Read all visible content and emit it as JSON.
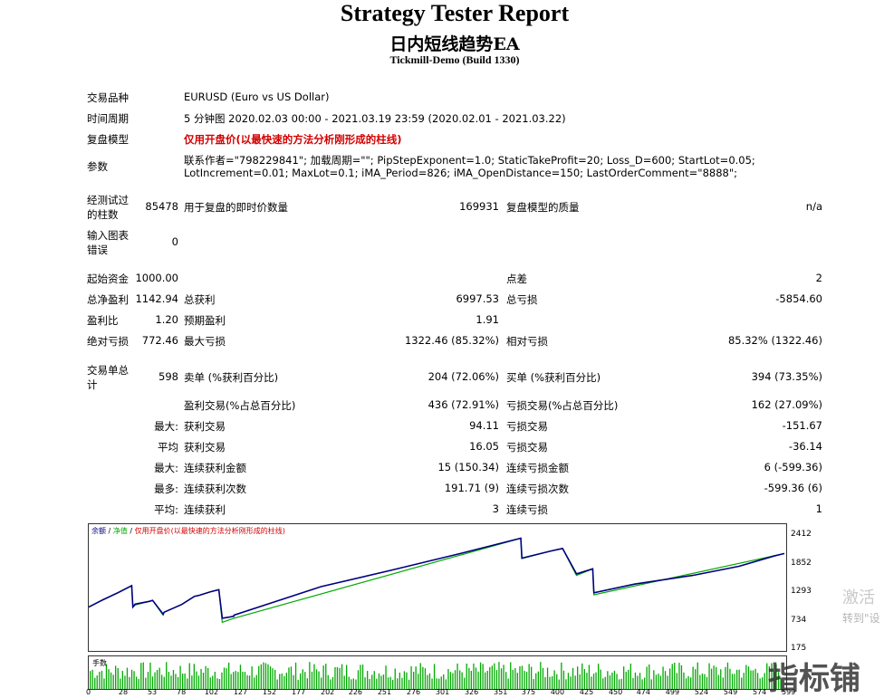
{
  "header": {
    "title": "Strategy Tester Report",
    "ea_name": "日内短线趋势EA",
    "build": "Tickmill-Demo (Build 1330)"
  },
  "info": {
    "symbol_label": "交易品种",
    "symbol_value": "EURUSD (Euro vs US Dollar)",
    "period_label": "时间周期",
    "period_value": "5 分钟图 2020.02.03 00:00 - 2021.03.19 23:59 (2020.02.01 - 2021.03.22)",
    "model_label": "复盘模型",
    "model_value": "仅用开盘价(以最快速的方法分析刚形成的柱线)",
    "params_label": "参数",
    "params_line1": "联系作者=\"798229841\"; 加载周期=\"\"; PipStepExponent=1.0; StaticTakeProfit=20; Loss_D=600; StartLot=0.05;",
    "params_line2": "LotIncrement=0.01; MaxLot=0.1; iMA_Period=826; iMA_OpenDistance=150; LastOrderComment=\"8888\";"
  },
  "bars": {
    "bars_label_1": "经测试过",
    "bars_label_2": "的柱数",
    "bars_value": "85478",
    "ticks_label": "用于复盘的即时价数量",
    "ticks_value": "169931",
    "quality_label": "复盘模型的质量",
    "quality_value": "n/a",
    "errors_label_1": "输入图表",
    "errors_label_2": "错误",
    "errors_value": "0"
  },
  "stats": {
    "deposit_label": "起始资金",
    "deposit_value": "1000.00",
    "spread_label": "点差",
    "spread_value": "2",
    "net_label": "总净盈利",
    "net_value": "1142.94",
    "gross_profit_label": "总获利",
    "gross_profit_value": "6997.53",
    "gross_loss_label": "总亏损",
    "gross_loss_value": "-5854.60",
    "pf_label": "盈利比",
    "pf_value": "1.20",
    "payoff_label": "预期盈利",
    "payoff_value": "1.91",
    "abs_dd_label": "绝对亏损",
    "abs_dd_value": "772.46",
    "max_dd_label": "最大亏损",
    "max_dd_value": "1322.46 (85.32%)",
    "rel_dd_label": "相对亏损",
    "rel_dd_value": "85.32% (1322.46)"
  },
  "trades": {
    "total_label_1": "交易单总",
    "total_label_2": "计",
    "total_value": "598",
    "short_label": "卖单 (%获利百分比)",
    "short_value": "204 (72.06%)",
    "long_label": "买单 (%获利百分比)",
    "long_value": "394 (73.35%)",
    "profit_trades_label": "盈利交易(%占总百分比)",
    "profit_trades_value": "436 (72.91%)",
    "loss_trades_label": "亏损交易(%占总百分比)",
    "loss_trades_value": "162 (27.09%)",
    "largest_label": "最大:",
    "largest_profit_label": "获利交易",
    "largest_profit_value": "94.11",
    "largest_loss_label": "亏损交易",
    "largest_loss_value": "-151.67",
    "average_label": "平均",
    "average_profit_label": "获利交易",
    "average_profit_value": "16.05",
    "average_loss_label": "亏损交易",
    "average_loss_value": "-36.14",
    "max_label": "最大:",
    "max_cons_wins_label": "连续获利金额",
    "max_cons_wins_value": "15 (150.34)",
    "max_cons_losses_label": "连续亏损金额",
    "max_cons_losses_value": "6 (-599.36)",
    "maximal_label": "最多:",
    "maximal_cons_profit_label": "连续获利次数",
    "maximal_cons_profit_value": "191.71 (9)",
    "maximal_cons_loss_label": "连续亏损次数",
    "maximal_cons_loss_value": "-599.36 (6)",
    "avg_label": "平均:",
    "avg_cons_wins_label": "连续获利",
    "avg_cons_wins_value": "3",
    "avg_cons_losses_label": "连续亏损",
    "avg_cons_losses_value": "1"
  },
  "graph": {
    "legend_balance": "余额",
    "legend_equity": "净值",
    "legend_model": "仅用开盘价(以最快速的方法分析刚形成的柱线)",
    "volume_label": "手数",
    "y_ticks": [
      "2412",
      "1852",
      "1293",
      "734",
      "175"
    ],
    "x_ticks": [
      "0",
      "28",
      "53",
      "78",
      "102",
      "127",
      "152",
      "177",
      "202",
      "226",
      "251",
      "276",
      "301",
      "326",
      "351",
      "375",
      "400",
      "425",
      "450",
      "474",
      "499",
      "524",
      "549",
      "574",
      "599"
    ],
    "balance_color": "#000080",
    "equity_color": "#00aa00",
    "model_color": "#d40000"
  },
  "chart_data": {
    "type": "line",
    "title": "",
    "xlabel": "",
    "ylabel": "",
    "ylim": [
      175,
      2412
    ],
    "xlim": [
      0,
      599
    ],
    "series": [
      {
        "name": "余额",
        "x": [
          0,
          12,
          25,
          37,
          38,
          40,
          52,
          55,
          64,
          65,
          80,
          91,
          95,
          105,
          112,
          115,
          125,
          125,
          200,
          260,
          320,
          372,
          373,
          398,
          408,
          420,
          434,
          435,
          470,
          520,
          560,
          590,
          599
        ],
        "values": [
          1000,
          1140,
          1280,
          1420,
          1000,
          1060,
          1110,
          1130,
          860,
          900,
          1050,
          1210,
          1230,
          1300,
          1340,
          780,
          820,
          840,
          1400,
          1720,
          2050,
          2350,
          1960,
          2100,
          2150,
          1650,
          1750,
          1280,
          1450,
          1620,
          1800,
          2000,
          2050
        ]
      },
      {
        "name": "净值",
        "x": [
          0,
          37,
          38,
          40,
          52,
          55,
          64,
          65,
          80,
          91,
          95,
          105,
          112,
          115,
          125,
          372,
          373,
          398,
          408,
          420,
          434,
          435,
          599
        ],
        "values": [
          1000,
          1420,
          1000,
          1040,
          1110,
          1130,
          840,
          900,
          1050,
          1210,
          1230,
          1300,
          1340,
          700,
          780,
          2350,
          1950,
          2100,
          2150,
          1620,
          1750,
          1240,
          2050
        ]
      }
    ]
  },
  "watermarks": {
    "activate": "激活",
    "goto": "转到\"设",
    "brand": "指标铺"
  }
}
